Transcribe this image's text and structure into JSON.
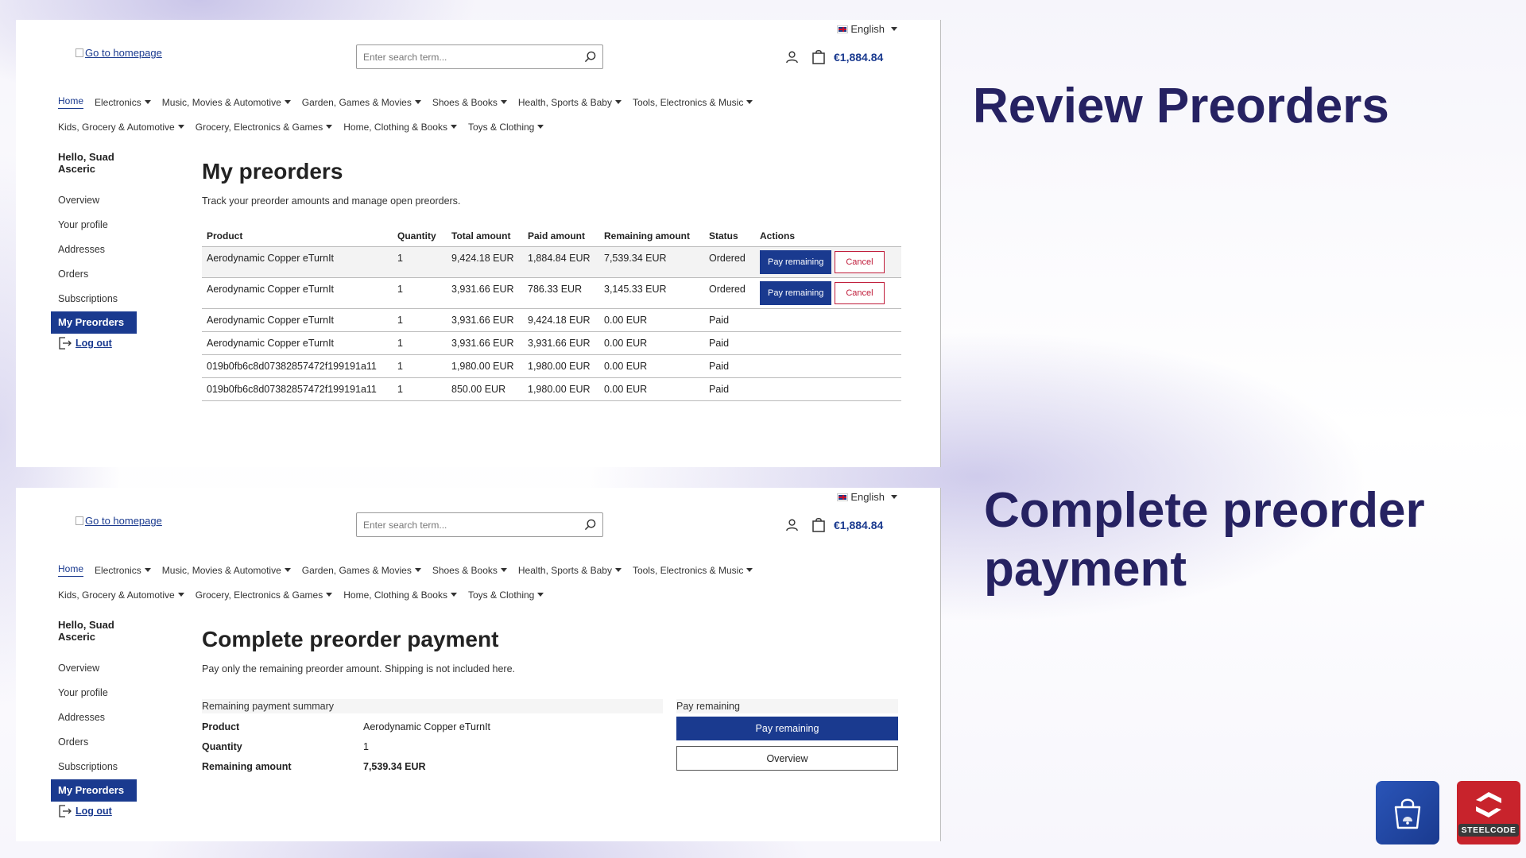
{
  "header": {
    "language": "English",
    "logo_alt": "Go to homepage",
    "search_placeholder": "Enter search term...",
    "cart_total": "€1,884.84"
  },
  "nav": {
    "row1": [
      {
        "label": "Home",
        "dropdown": false,
        "active": true
      },
      {
        "label": "Electronics",
        "dropdown": true
      },
      {
        "label": "Music, Movies & Automotive",
        "dropdown": true
      },
      {
        "label": "Garden, Games & Movies",
        "dropdown": true
      },
      {
        "label": "Shoes & Books",
        "dropdown": true
      },
      {
        "label": "Health, Sports & Baby",
        "dropdown": true
      },
      {
        "label": "Tools, Electronics & Music",
        "dropdown": true
      }
    ],
    "row2": [
      {
        "label": "Kids, Grocery & Automotive",
        "dropdown": true
      },
      {
        "label": "Grocery, Electronics & Games",
        "dropdown": true
      },
      {
        "label": "Home, Clothing & Books",
        "dropdown": true
      },
      {
        "label": "Toys & Clothing",
        "dropdown": true
      }
    ]
  },
  "sidebar": {
    "greeting": "Hello, Suad Asceric",
    "items": [
      "Overview",
      "Your profile",
      "Addresses",
      "Orders",
      "Subscriptions",
      "My Preorders"
    ],
    "active": "My Preorders",
    "logout": "Log out"
  },
  "preorders": {
    "title": "My preorders",
    "description": "Track your preorder amounts and manage open preorders.",
    "columns": [
      "Product",
      "Quantity",
      "Total amount",
      "Paid amount",
      "Remaining amount",
      "Status",
      "Actions"
    ],
    "pay_label": "Pay remaining",
    "cancel_label": "Cancel",
    "rows": [
      {
        "product": "Aerodynamic Copper eTurnIt",
        "quantity": "1",
        "total": "9,424.18 EUR",
        "paid": "1,884.84 EUR",
        "remaining": "7,539.34 EUR",
        "status": "Ordered",
        "actions": true
      },
      {
        "product": "Aerodynamic Copper eTurnIt",
        "quantity": "1",
        "total": "3,931.66 EUR",
        "paid": "786.33 EUR",
        "remaining": "3,145.33 EUR",
        "status": "Ordered",
        "actions": true
      },
      {
        "product": "Aerodynamic Copper eTurnIt",
        "quantity": "1",
        "total": "3,931.66 EUR",
        "paid": "9,424.18 EUR",
        "remaining": "0.00 EUR",
        "status": "Paid",
        "actions": false
      },
      {
        "product": "Aerodynamic Copper eTurnIt",
        "quantity": "1",
        "total": "3,931.66 EUR",
        "paid": "3,931.66 EUR",
        "remaining": "0.00 EUR",
        "status": "Paid",
        "actions": false
      },
      {
        "product": "019b0fb6c8d07382857472f199191a11",
        "quantity": "1",
        "total": "1,980.00 EUR",
        "paid": "1,980.00 EUR",
        "remaining": "0.00 EUR",
        "status": "Paid",
        "actions": false
      },
      {
        "product": "019b0fb6c8d07382857472f199191a11",
        "quantity": "1",
        "total": "850.00 EUR",
        "paid": "1,980.00 EUR",
        "remaining": "0.00 EUR",
        "status": "Paid",
        "actions": false
      }
    ]
  },
  "payment": {
    "title": "Complete preorder payment",
    "description": "Pay only the remaining preorder amount. Shipping is not included here.",
    "summary_heading": "Remaining payment summary",
    "product_label": "Product",
    "product_value": "Aerodynamic Copper eTurnIt",
    "quantity_label": "Quantity",
    "quantity_value": "1",
    "remaining_label": "Remaining amount",
    "remaining_value": "7,539.34 EUR",
    "pay_heading": "Pay remaining",
    "pay_button": "Pay remaining",
    "overview_button": "Overview"
  },
  "headings": {
    "review": "Review Preorders",
    "complete": "Complete preorder payment"
  },
  "branding": {
    "steelcode": "STEELCODE"
  },
  "colors": {
    "primary": "#1a3a8f",
    "danger": "#c01c3a",
    "heading": "#262262",
    "steelcode_red": "#c8232c"
  }
}
